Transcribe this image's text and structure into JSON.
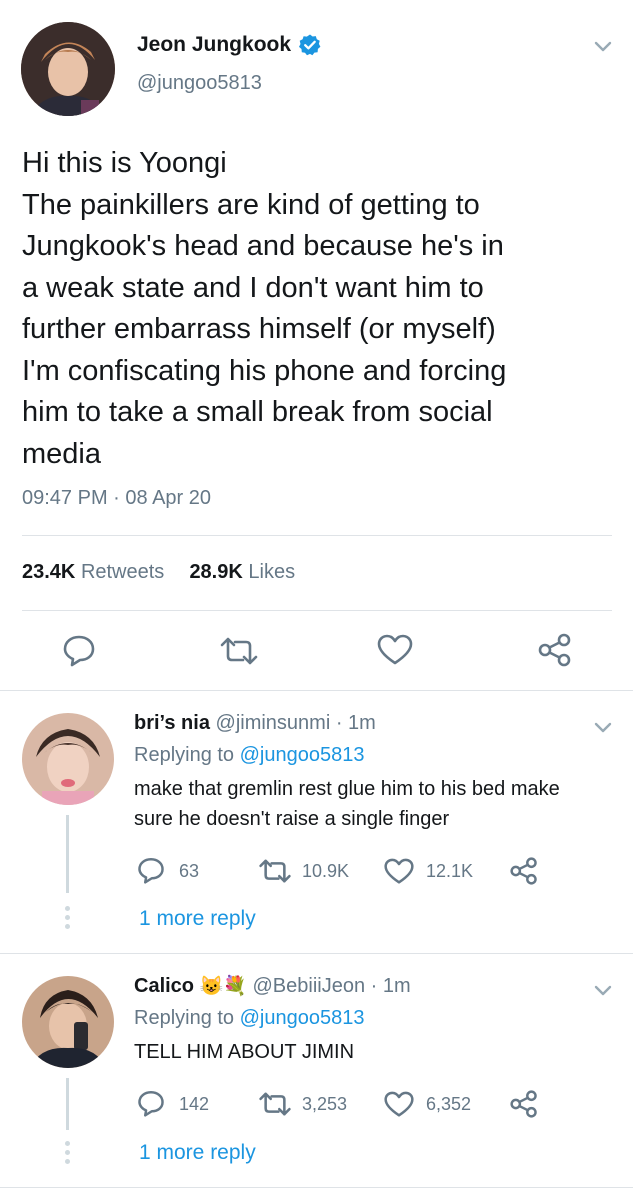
{
  "tweet": {
    "display_name": "Jeon Jungkook",
    "handle": "@jungoo5813",
    "lines": [
      "Hi this is Yoongi",
      "The painkillers are kind of getting to",
      "Jungkook's head and because he's in",
      "a weak state and I don't want him to",
      "further embarrass himself (or myself)",
      "I'm confiscating his phone and forcing",
      "him to take a small break from social",
      "media"
    ],
    "timestamp": "09:47 PM · 08 Apr 20",
    "retweets_count": "23.4K",
    "retweets_label": "Retweets",
    "likes_count": "28.9K",
    "likes_label": "Likes"
  },
  "replies": [
    {
      "display_name": "bri’s nia",
      "handle": "@jiminsunmi",
      "time": "· 1m",
      "replying_prefix": "Replying to",
      "replying_handle": "@jungoo5813",
      "lines": [
        "make that gremlin rest glue him to his bed make",
        "sure he doesn't raise a single finger"
      ],
      "reply_count": "63",
      "retweet_count": "10.9K",
      "like_count": "12.1K",
      "more_replies": "1 more reply"
    },
    {
      "display_name": "Calico",
      "emojis": "😺💐",
      "handle": "@BebiiiJeon",
      "time": "· 1m",
      "replying_prefix": "Replying to",
      "replying_handle": "@jungoo5813",
      "lines": [
        "TELL HIM ABOUT JIMIN"
      ],
      "reply_count": "142",
      "retweet_count": "3,253",
      "like_count": "6,352",
      "more_replies": "1 more reply"
    }
  ],
  "colors": {
    "accent": "#1b95e0",
    "secondary_text": "#657786",
    "icon": "#657786",
    "divider": "#dfe3e7"
  }
}
